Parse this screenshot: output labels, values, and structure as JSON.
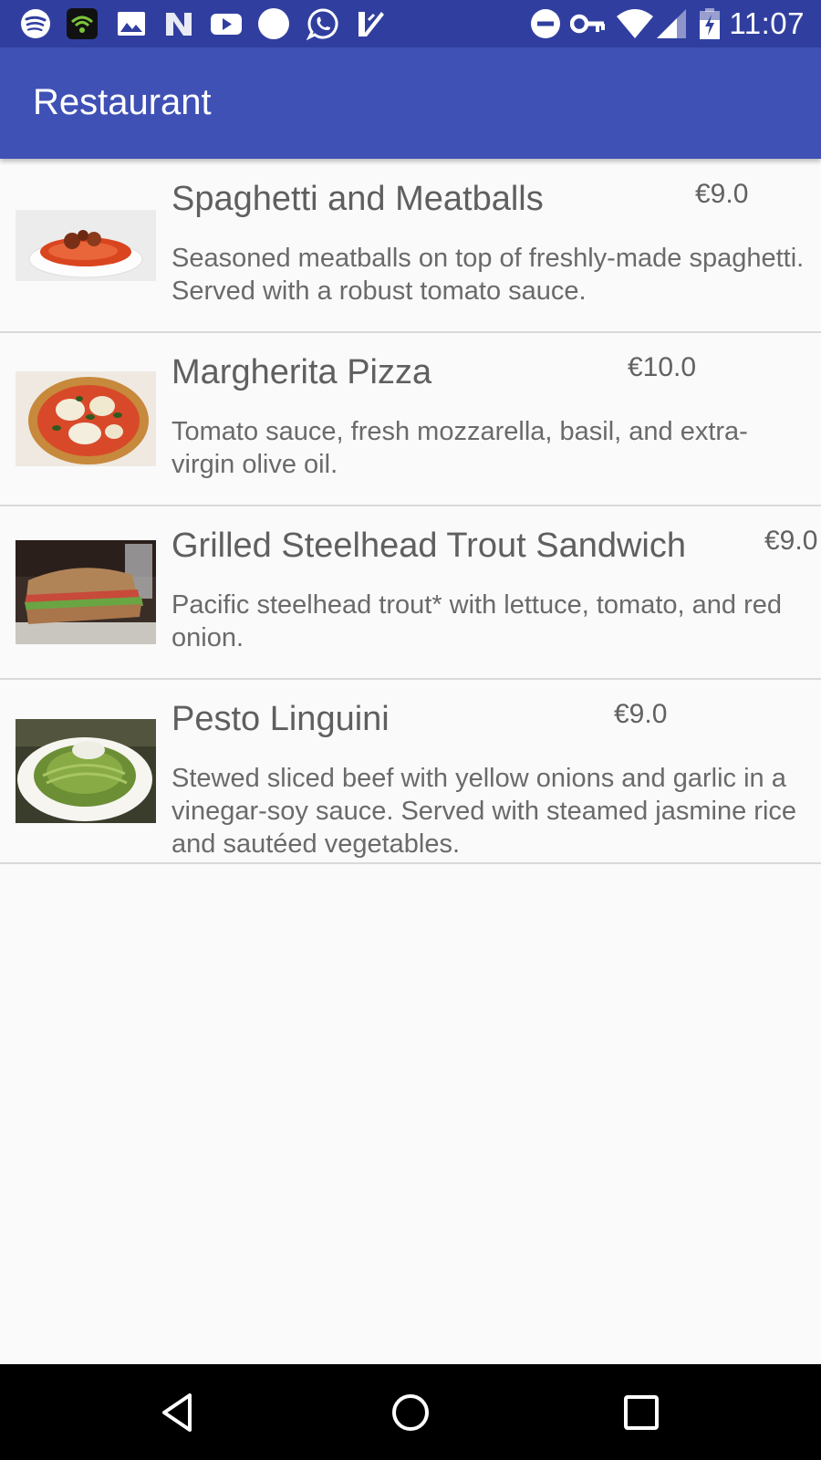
{
  "status_bar": {
    "time": "11:07",
    "left_icons": [
      "spotify-icon",
      "wifi-app-icon",
      "gallery-icon",
      "n-app-icon",
      "youtube-icon",
      "circle-notification-icon",
      "whatsapp-icon",
      "ticket-icon"
    ],
    "right_icons": [
      "do-not-disturb-icon",
      "vpn-key-icon",
      "wifi-signal-icon",
      "cell-signal-icon",
      "battery-charging-icon"
    ]
  },
  "app_bar": {
    "title": "Restaurant"
  },
  "menu": {
    "items": [
      {
        "name": "Spaghetti and Meatballs",
        "price": "€9.0",
        "description": "Seasoned meatballs on top of freshly-made spaghetti. Served with a robust tomato sauce.",
        "image": "spaghetti-meatballs-photo"
      },
      {
        "name": "Margherita Pizza",
        "price": "€10.0",
        "description": "Tomato sauce, fresh mozzarella, basil, and extra-virgin olive oil.",
        "image": "margherita-pizza-photo"
      },
      {
        "name": "Grilled Steelhead Trout Sandwich",
        "price": "€9.0",
        "description": "Pacific steelhead trout* with lettuce, tomato, and red onion.",
        "image": "trout-sandwich-photo"
      },
      {
        "name": "Pesto Linguini",
        "price": "€9.0",
        "description": "Stewed sliced beef with yellow onions and garlic in a vinegar-soy sauce. Served with steamed jasmine rice and sautéed vegetables.",
        "image": "pesto-linguini-photo"
      }
    ]
  },
  "nav_bar": {
    "buttons": [
      "back-icon",
      "home-icon",
      "recents-icon"
    ]
  },
  "colors": {
    "status_bar": "#303f9f",
    "app_bar": "#3f51b5",
    "background": "#fafafa",
    "nav_bar": "#000000"
  }
}
